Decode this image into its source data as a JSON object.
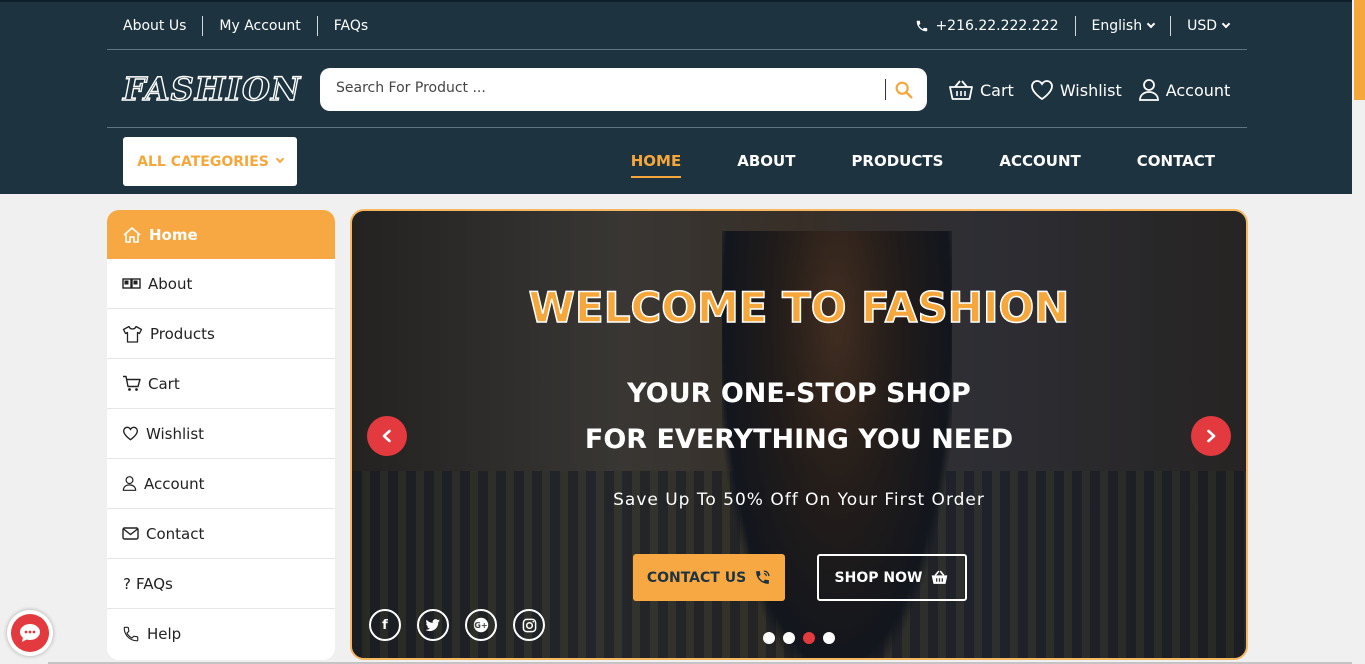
{
  "topbar": {
    "links": [
      "About Us",
      "My Account",
      "FAQs"
    ],
    "phone": "+216.22.222.222",
    "language": "English",
    "currency": "USD"
  },
  "brand": {
    "logo": "FASHION"
  },
  "search": {
    "placeholder": "Search For Product ..."
  },
  "header_actions": {
    "cart": "Cart",
    "wishlist": "Wishlist",
    "account": "Account"
  },
  "nav": {
    "all_categories": "ALL CATEGORIES",
    "items": [
      "HOME",
      "ABOUT",
      "PRODUCTS",
      "ACCOUNT",
      "CONTACT"
    ],
    "active": "HOME"
  },
  "sidebar": {
    "items": [
      {
        "label": "Home",
        "icon": "home-icon"
      },
      {
        "label": "About",
        "icon": "book-icon"
      },
      {
        "label": "Products",
        "icon": "tshirt-icon"
      },
      {
        "label": "Cart",
        "icon": "cart-icon"
      },
      {
        "label": "Wishlist",
        "icon": "heart-icon"
      },
      {
        "label": "Account",
        "icon": "user-icon"
      },
      {
        "label": "Contact",
        "icon": "envelope-icon"
      },
      {
        "label": "FAQs",
        "icon": "question-icon"
      },
      {
        "label": "Help",
        "icon": "phone-icon"
      }
    ]
  },
  "hero": {
    "title": "WELCOME TO FASHION",
    "line1": "YOUR ONE-STOP SHOP",
    "line2": "FOR EVERYTHING YOU NEED",
    "subtitle": "Save Up To 50% Off On Your First Order",
    "contact_button": "CONTACT US",
    "shop_button": "SHOP NOW",
    "slides": 4,
    "active_slide": 3
  },
  "colors": {
    "primary": "#1d333f",
    "accent": "#f6a73b",
    "red": "#e23a3e"
  }
}
